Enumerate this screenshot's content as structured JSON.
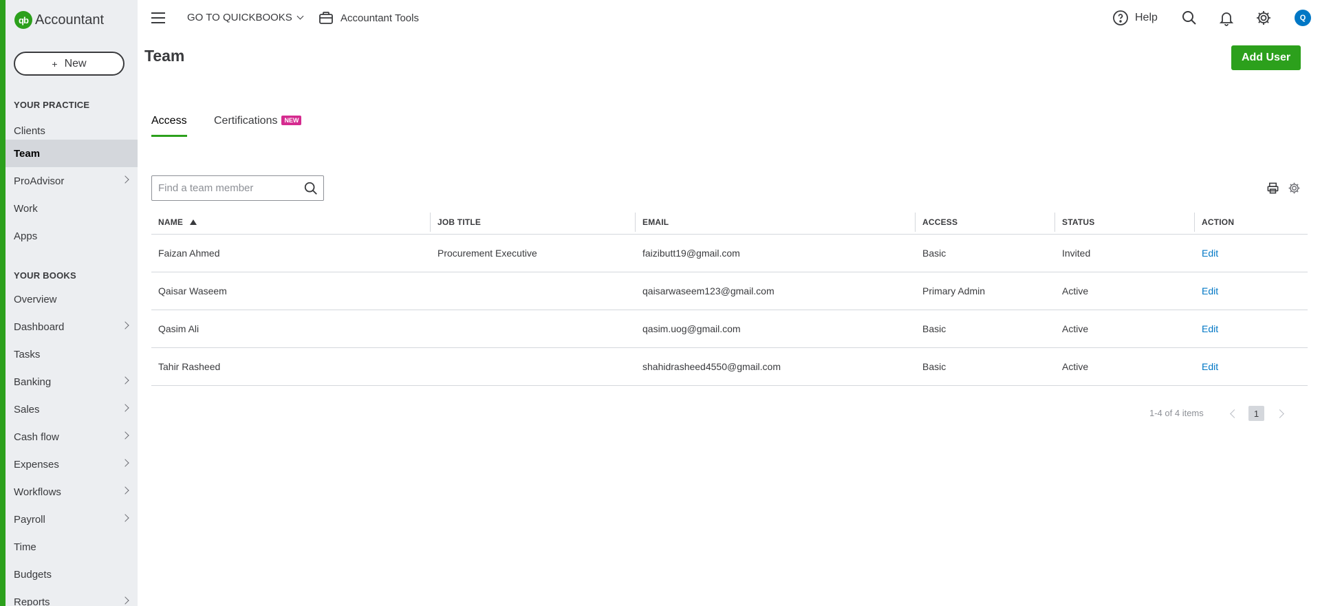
{
  "app": {
    "logo_mark": "qb",
    "logo_text": "Accountant"
  },
  "sidebar": {
    "new_label": "New",
    "section_practice": "YOUR PRACTICE",
    "practice_items": [
      {
        "label": "Clients"
      },
      {
        "label": "Team"
      },
      {
        "label": "ProAdvisor"
      },
      {
        "label": "Work"
      },
      {
        "label": "Apps"
      }
    ],
    "section_books": "YOUR BOOKS",
    "books_items": [
      {
        "label": "Overview"
      },
      {
        "label": "Dashboard"
      },
      {
        "label": "Tasks"
      },
      {
        "label": "Banking"
      },
      {
        "label": "Sales"
      },
      {
        "label": "Cash flow"
      },
      {
        "label": "Expenses"
      },
      {
        "label": "Workflows"
      },
      {
        "label": "Payroll"
      },
      {
        "label": "Time"
      },
      {
        "label": "Budgets"
      },
      {
        "label": "Reports"
      }
    ],
    "active_item": "Team"
  },
  "topbar": {
    "goto_label": "GO TO QUICKBOOKS",
    "tools_label": "Accountant Tools",
    "help_label": "Help",
    "avatar_initial": "Q"
  },
  "page": {
    "title": "Team",
    "add_user_label": "Add User",
    "tabs": [
      {
        "label": "Access"
      },
      {
        "label": "Certifications",
        "badge": "NEW"
      }
    ],
    "active_tab": "Access"
  },
  "search": {
    "placeholder": "Find a team member",
    "value": ""
  },
  "table": {
    "columns": [
      "NAME",
      "JOB TITLE",
      "EMAIL",
      "ACCESS",
      "STATUS",
      "ACTION"
    ],
    "sort_column": "NAME",
    "sort_direction": "ascending",
    "rows": [
      {
        "name": "Faizan Ahmed",
        "job_title": "Procurement Executive",
        "email": "faizibutt19@gmail.com",
        "access": "Basic",
        "status": "Invited",
        "action": "Edit"
      },
      {
        "name": "Qaisar Waseem",
        "job_title": "",
        "email": "qaisarwaseem123@gmail.com",
        "access": "Primary Admin",
        "status": "Active",
        "action": "Edit"
      },
      {
        "name": "Qasim Ali",
        "job_title": "",
        "email": "qasim.uog@gmail.com",
        "access": "Basic",
        "status": "Active",
        "action": "Edit"
      },
      {
        "name": "Tahir Rasheed",
        "job_title": "",
        "email": "shahidrasheed4550@gmail.com",
        "access": "Basic",
        "status": "Active",
        "action": "Edit"
      }
    ]
  },
  "pagination": {
    "summary": "1-4 of 4 items",
    "current_page": "1"
  },
  "colors": {
    "brand_green": "#2ca01c",
    "link_blue": "#0077c5",
    "badge_pink": "#d52b8f",
    "sidebar_bg": "#eceef1"
  },
  "icons": [
    "hamburger-icon",
    "chevron-down-icon",
    "briefcase-icon",
    "help-circle-icon",
    "search-icon",
    "bell-icon",
    "gear-icon",
    "print-icon",
    "settings-gear-icon",
    "sort-up-icon",
    "chevron-right-icon",
    "chevron-left-icon"
  ]
}
